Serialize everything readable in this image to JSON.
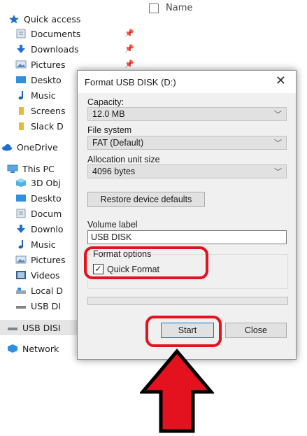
{
  "explorer": {
    "column_header": "Name",
    "nav": [
      {
        "label": "Quick access",
        "icon": "star-icon"
      },
      {
        "label": "Documents",
        "icon": "documents-icon",
        "pinned": true
      },
      {
        "label": "Downloads",
        "icon": "download-arrow-icon",
        "pinned": true
      },
      {
        "label": "Pictures",
        "icon": "pictures-icon",
        "pinned": true
      },
      {
        "label": "Deskto",
        "icon": "desktop-icon"
      },
      {
        "label": "Music",
        "icon": "music-note-icon"
      },
      {
        "label": "Screens",
        "icon": "folder-icon"
      },
      {
        "label": "Slack D",
        "icon": "folder-icon"
      },
      {
        "label": "OneDrive",
        "icon": "cloud-icon"
      },
      {
        "label": "This PC",
        "icon": "computer-icon"
      },
      {
        "label": "3D Obj",
        "icon": "3d-objects-icon"
      },
      {
        "label": "Deskto",
        "icon": "desktop-icon"
      },
      {
        "label": "Docum",
        "icon": "documents-icon"
      },
      {
        "label": "Downlo",
        "icon": "download-arrow-icon"
      },
      {
        "label": "Music",
        "icon": "music-note-icon"
      },
      {
        "label": "Pictures",
        "icon": "pictures-icon"
      },
      {
        "label": "Videos",
        "icon": "videos-icon"
      },
      {
        "label": "Local D",
        "icon": "drive-icon"
      },
      {
        "label": "USB DI",
        "icon": "usb-drive-icon"
      },
      {
        "label": "USB DISI",
        "icon": "usb-drive-icon"
      },
      {
        "label": "Network",
        "icon": "network-icon"
      }
    ]
  },
  "dialog": {
    "title": "Format USB DISK (D:)",
    "close_glyph": "✕",
    "capacity_label": "Capacity:",
    "capacity_value": "12.0 MB",
    "filesystem_label": "File system",
    "filesystem_value": "FAT (Default)",
    "allocation_label": "Allocation unit size",
    "allocation_value": "4096 bytes",
    "restore_button": "Restore device defaults",
    "volume_label": "Volume label",
    "volume_value": "USB DISK",
    "format_options_label": "Format options",
    "quick_format_label": "Quick Format",
    "quick_format_checked": true,
    "start_button": "Start",
    "close_button": "Close"
  },
  "annotation": {
    "highlight_color": "#e3121e",
    "arrow_fill": "#e3121e",
    "arrow_stroke": "#000000"
  },
  "colors": {
    "star": "#1f6fd0",
    "folder": "#e8b93a",
    "cloud": "#1e6ed3",
    "dialog_bg": "#f0f0f0"
  }
}
